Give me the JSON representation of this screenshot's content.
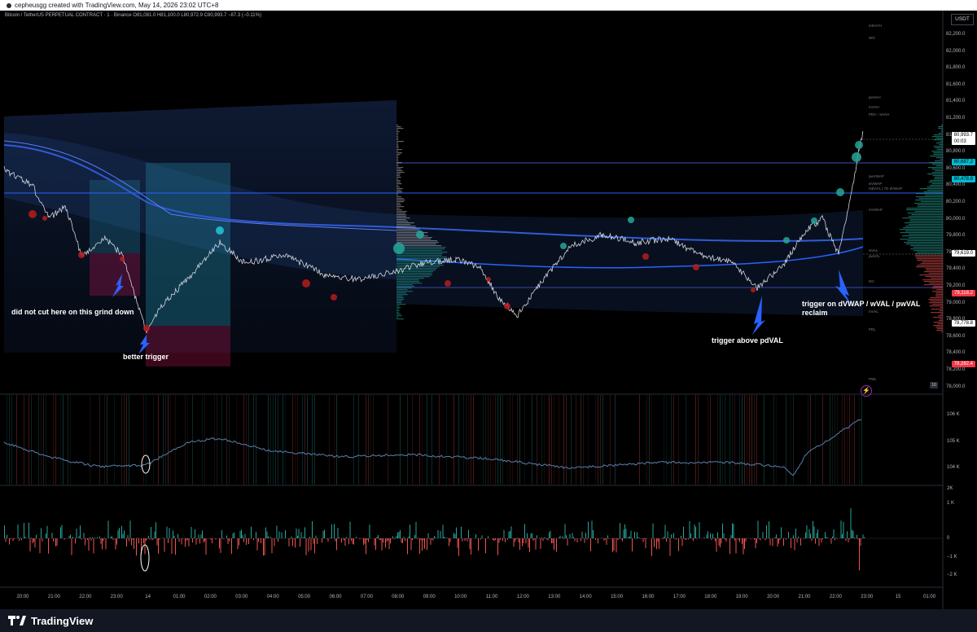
{
  "header": {
    "credit": "cepheusgg created with TradingView.com, May 14, 2026 23:02 UTC+8"
  },
  "symbol": {
    "title": "Bitcoin / TetherUS PERPETUAL CONTRACT · 1 · Binance",
    "ohlc": "O81,081.0 H81,100.0 L80,972.9 C80,993.7 −87.3 (−0.11%)"
  },
  "currency": "USDT",
  "price_axis": [
    "82,200.0",
    "82,000.0",
    "81,800.0",
    "81,600.0",
    "81,400.0",
    "81,200.0",
    "81,000.0",
    "80,800.0",
    "80,600.0",
    "80,400.0",
    "80,200.0",
    "80,000.0",
    "79,800.0",
    "79,600.0",
    "79,400.0",
    "79,200.0",
    "79,000.0",
    "78,800.0",
    "78,600.0",
    "78,400.0",
    "78,200.0",
    "78,000.0"
  ],
  "price_tags": [
    {
      "text": "80,993.7",
      "sub": "00:03",
      "bg": "#ffffff"
    },
    {
      "text": "80,687.2",
      "bg": "#00bcd4"
    },
    {
      "text": "80,478.8",
      "bg": "#00bcd4"
    },
    {
      "text": "79,619.0",
      "bg": "#ffffff"
    },
    {
      "text": "79,118.2",
      "bg": "#f23645"
    },
    {
      "text": "78,778.8",
      "bg": "#ffffff"
    },
    {
      "text": "78,282.4",
      "bg": "#f23645"
    }
  ],
  "level_labels": [
    "mDAYH",
    "WO",
    "pwVAH",
    "mVAH",
    "PDH : wVAH",
    "pwVWAP",
    "wVWAP",
    "mDAYL | 7D dVWAP",
    "mVWAP",
    "wVAL",
    "pwVAL",
    "DO",
    "mVAL",
    "PDL",
    "PWL"
  ],
  "cvd_axis": [
    "106 K",
    "105 K",
    "104 K"
  ],
  "delta_axis": [
    "2K",
    "1 K",
    "0",
    "−1 K",
    "−2 K"
  ],
  "time_axis": [
    "20:00",
    "21:00",
    "22:00",
    "23:00",
    "14",
    "01:00",
    "02:00",
    "03:00",
    "04:00",
    "05:00",
    "06:00",
    "07:00",
    "08:00",
    "09:00",
    "10:00",
    "11:00",
    "12:00",
    "13:00",
    "14:00",
    "15:00",
    "16:00",
    "17:00",
    "18:00",
    "19:00",
    "20:00",
    "21:00",
    "22:00",
    "23:00",
    "15",
    "01:00"
  ],
  "annotations": {
    "grind": "did not cut here on this grind down",
    "better": "better trigger",
    "pdval": "trigger above pdVAL",
    "reclaim_1": "trigger on dVWAP / wVAL / pwVAL",
    "reclaim_2": "reclaim"
  },
  "badge": "10",
  "footer": {
    "brand": "TradingView"
  },
  "colors": {
    "up": "#26a69a",
    "down": "#ef5350",
    "vwap": "#2962ff",
    "accent": "#00bcd4"
  }
}
